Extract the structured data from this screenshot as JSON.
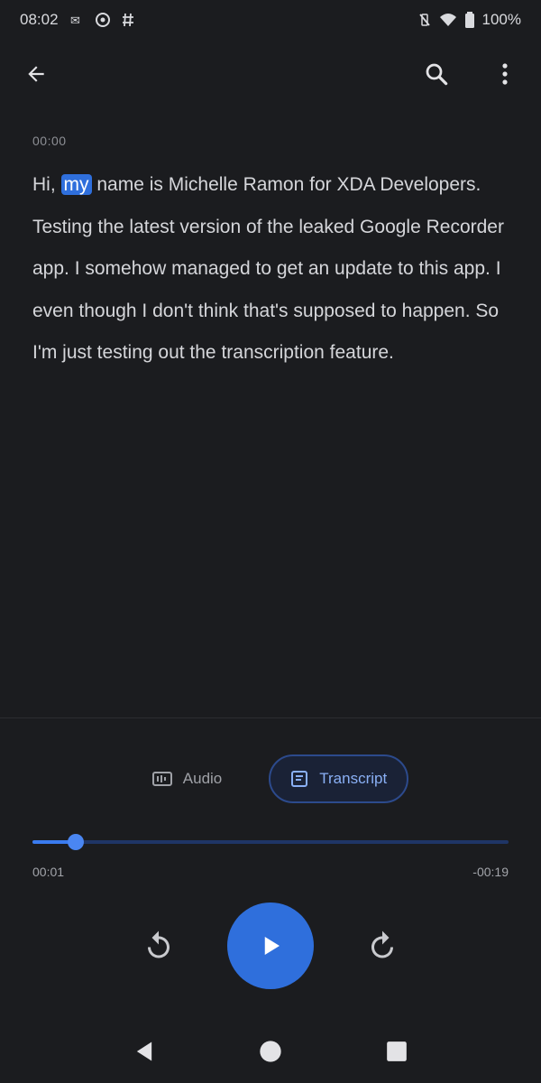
{
  "status_bar": {
    "time": "08:02",
    "battery": "100%"
  },
  "app_bar": {
    "back_icon": "arrow-back-icon",
    "search_icon": "search-icon",
    "more_icon": "more-vert-icon"
  },
  "transcript": {
    "speaker": "00:00",
    "before": "Hi,",
    "highlight": "my",
    "after": "name is Michelle Ramon for XDA Developers. Testing the latest version of the leaked Google Recorder app. I somehow managed to get an update to this app. I even though I don't think that's supposed to happen. So I'm just testing out the transcription feature."
  },
  "tabs": {
    "audio_label": "Audio",
    "transcript_label": "Transcript"
  },
  "player": {
    "elapsed": "00:01",
    "remaining": "-00:19",
    "progress": 0.09
  },
  "colors": {
    "accent": "#2f6fdc",
    "background": "#1b1c1f"
  }
}
